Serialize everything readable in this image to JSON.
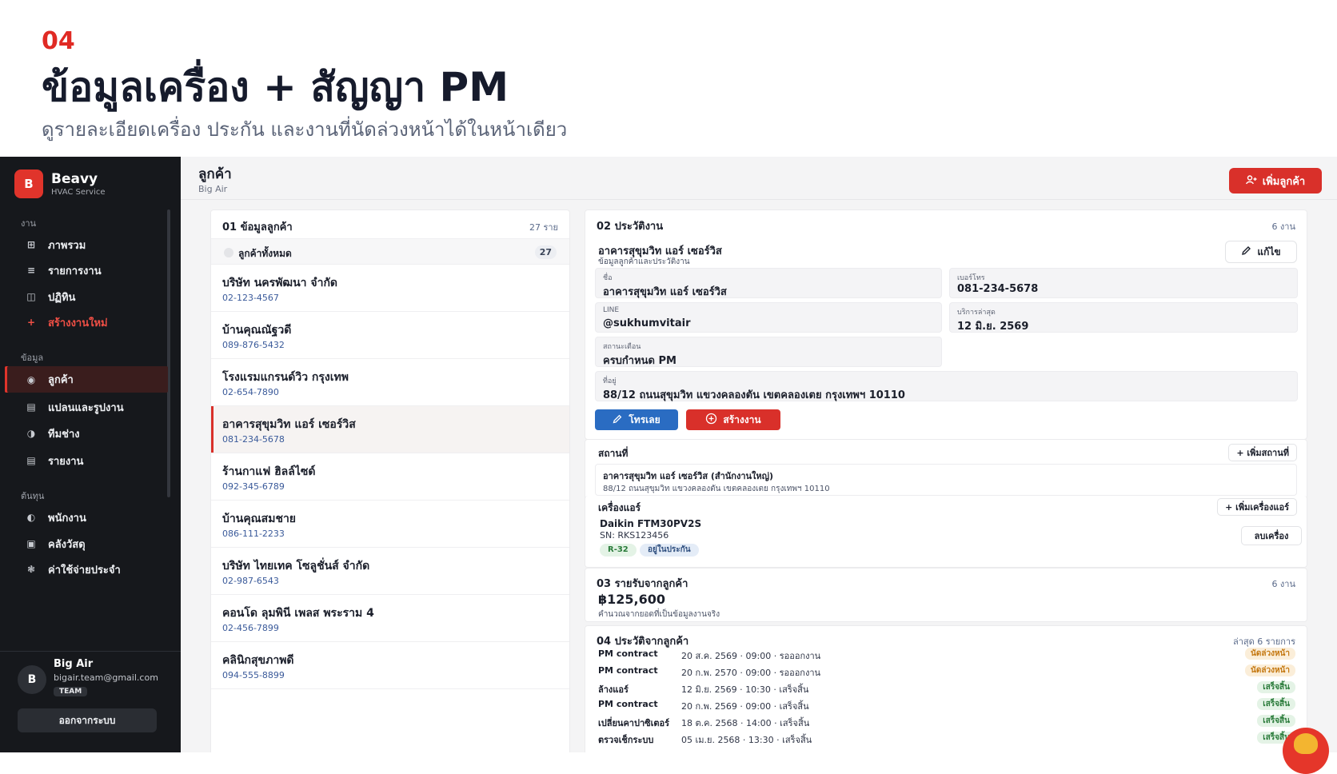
{
  "hero": {
    "number": "04",
    "title": "ข้อมูลเครื่อง + สัญญา PM",
    "subtitle": "ดูรายละเอียดเครื่อง ประกัน และงานที่นัดล่วงหน้าได้ในหน้าเดียว"
  },
  "sidebar": {
    "logo_letter": "B",
    "brand_name": "Beavy",
    "brand_tagline": "HVAC Service",
    "sections": [
      {
        "label": "งาน",
        "items": [
          {
            "icon": "grid-icon",
            "glyph": "⊞",
            "label": "ภาพรวม"
          },
          {
            "icon": "list-icon",
            "glyph": "≡",
            "label": "รายการงาน"
          },
          {
            "icon": "calendar-icon",
            "glyph": "◫",
            "label": "ปฏิทิน"
          },
          {
            "icon": "plus-icon",
            "glyph": "+",
            "label": "สร้างงานใหม่"
          }
        ]
      },
      {
        "label": "ข้อมูล",
        "items": [
          {
            "icon": "eye-icon",
            "glyph": "◉",
            "label": "ลูกค้า"
          },
          {
            "icon": "blueprint-icon",
            "glyph": "▤",
            "label": "แปลนและรูปงาน"
          },
          {
            "icon": "team-icon",
            "glyph": "◑",
            "label": "ทีมช่าง"
          },
          {
            "icon": "report-icon",
            "glyph": "▤",
            "label": "รายงาน"
          }
        ]
      },
      {
        "label": "ต้นทุน",
        "items": [
          {
            "icon": "staff-icon",
            "glyph": "◐",
            "label": "พนักงาน"
          },
          {
            "icon": "warehouse-icon",
            "glyph": "▣",
            "label": "คลังวัสดุ"
          },
          {
            "icon": "expense-icon",
            "glyph": "❃",
            "label": "ค่าใช้จ่ายประจำ"
          }
        ]
      }
    ],
    "user": {
      "avatar_letter": "B",
      "name": "Big Air",
      "email": "bigair.team@gmail.com",
      "badge": "TEAM"
    },
    "logout_label": "ออกจากระบบ"
  },
  "topbar": {
    "title": "ลูกค้า",
    "subtitle": "Big Air",
    "add_button_label": "เพิ่มลูกค้า"
  },
  "customer_list": {
    "title": "01 ข้อมูลลูกค้า",
    "count": "27 ราย",
    "filter_label": "ลูกค้าทั้งหมด",
    "filter_count": "27",
    "items": [
      {
        "name": "บริษัท นครพัฒนา จำกัด",
        "phone": "02-123-4567"
      },
      {
        "name": "บ้านคุณณัฐวดี",
        "phone": "089-876-5432"
      },
      {
        "name": "โรงแรมแกรนด์วิว กรุงเทพ",
        "phone": "02-654-7890"
      },
      {
        "name": "อาคารสุขุมวิท แอร์ เซอร์วิส",
        "phone": "081-234-5678"
      },
      {
        "name": "ร้านกาแฟ ฮิลล์ไซด์",
        "phone": "092-345-6789"
      },
      {
        "name": "บ้านคุณสมชาย",
        "phone": "086-111-2233"
      },
      {
        "name": "บริษัท ไทยเทค โซลูชั่นส์ จำกัด",
        "phone": "02-987-6543"
      },
      {
        "name": "คอนโด ลุมพินี เพลส พระราม 4",
        "phone": "02-456-7899"
      },
      {
        "name": "คลินิกสุขภาพดี",
        "phone": "094-555-8899"
      }
    ]
  },
  "detail": {
    "title": "02 ประวัติงาน",
    "count": "6 งาน",
    "name": "อาคารสุขุมวิท แอร์ เซอร์วิส",
    "subtitle": "ข้อมูลลูกค้าและประวัติงาน",
    "edit_label": "แก้ไข",
    "fields": {
      "name_label": "ชื่อ",
      "name_value": "อาคารสุขุมวิท แอร์ เซอร์วิส",
      "phone_label": "เบอร์โทร",
      "phone_value": "081-234-5678",
      "line_label": "LINE",
      "line_value": "@sukhumvitair",
      "last_service_label": "บริการล่าสุด",
      "last_service_value": "12 มิ.ย. 2569",
      "alert_label": "สถานะเตือน",
      "alert_value": "ครบกำหนด PM",
      "address_label": "ที่อยู่",
      "address_value": "88/12 ถนนสุขุมวิท แขวงคลองตัน เขตคลองเตย กรุงเทพฯ 10110"
    },
    "call_label": "โทรเลย",
    "create_job_label": "สร้างงาน",
    "locations": {
      "title": "สถานที่",
      "add_label": "+ เพิ่มสถานที่",
      "name": "อาคารสุขุมวิท แอร์ เซอร์วิส (สำนักงานใหญ่)",
      "address": "88/12 ถนนสุขุมวิท แขวงคลองตัน เขตคลองเตย กรุงเทพฯ 10110"
    },
    "aircon": {
      "title": "เครื่องแอร์",
      "add_label": "+ เพิ่มเครื่องแอร์",
      "model": "Daikin FTM30PV2S",
      "serial": "SN: RKS123456",
      "refrigerant": "R-32",
      "warranty": "อยู่ในประกัน",
      "remove_label": "ลบเครื่อง"
    }
  },
  "income": {
    "title": "03 รายรับจากลูกค้า",
    "count": "6 งาน",
    "total": "฿125,600",
    "note": "คำนวณจากยอดที่เป็นข้อมูลงานจริง"
  },
  "history": {
    "title": "04 ประวัติจากลูกค้า",
    "meta": "ล่าสุด 6 รายการ",
    "rows": [
      {
        "type": "PM contract",
        "when": "20 ส.ค. 2569 · 09:00 · รอออกงาน",
        "status": "นัดล่วงหน้า",
        "kind": "pending"
      },
      {
        "type": "PM contract",
        "when": "20 ก.พ. 2570 · 09:00 · รอออกงาน",
        "status": "นัดล่วงหน้า",
        "kind": "pending"
      },
      {
        "type": "ล้างแอร์",
        "when": "12 มิ.ย. 2569 · 10:30 · เสร็จสิ้น",
        "status": "เสร็จสิ้น",
        "kind": "done"
      },
      {
        "type": "PM contract",
        "when": "20 ก.พ. 2569 · 09:00 · เสร็จสิ้น",
        "status": "เสร็จสิ้น",
        "kind": "done"
      },
      {
        "type": "เปลี่ยนคาปาซิเตอร์",
        "when": "18 ต.ค. 2568 · 14:00 · เสร็จสิ้น",
        "status": "เสร็จสิ้น",
        "kind": "done"
      },
      {
        "type": "ตรวจเช็กระบบ",
        "when": "05 เม.ย. 2568 · 13:30 · เสร็จสิ้น",
        "status": "เสร็จสิ้น",
        "kind": "done"
      }
    ]
  },
  "colors": {
    "accent": "#d9302a",
    "sidebar": "#16181c",
    "call": "#2a6cc2"
  }
}
